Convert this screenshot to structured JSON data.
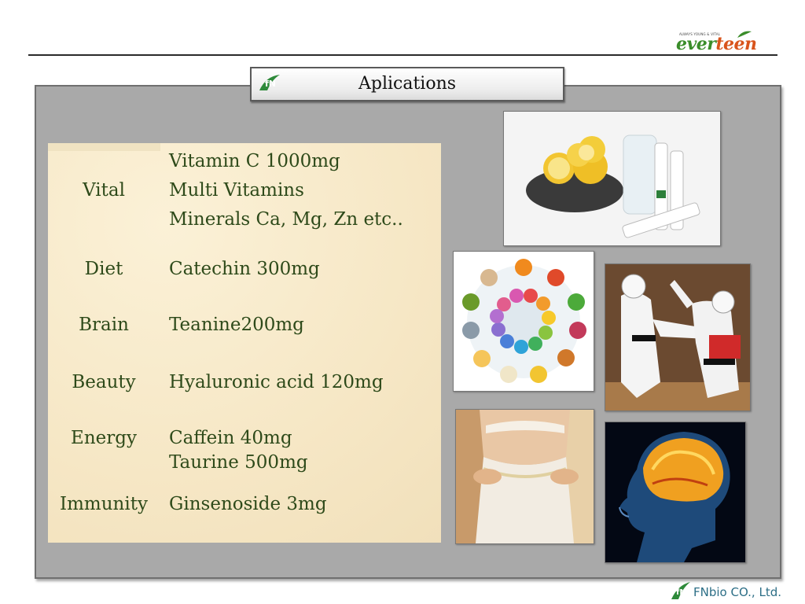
{
  "brand": {
    "tagline": "ALWAYS YOUNG & VITAL",
    "logo_left": "ever",
    "logo_right": "teen"
  },
  "title": "Aplications",
  "rows": [
    {
      "category": "Vital",
      "lines": [
        "Vitamin C 1000mg",
        "Multi Vitamins",
        "Minerals Ca, Mg, Zn etc.."
      ]
    },
    {
      "category": "Diet",
      "lines": [
        "Catechin 300mg"
      ]
    },
    {
      "category": "Brain",
      "lines": [
        "Teanine200mg"
      ]
    },
    {
      "category": "Beauty",
      "lines": [
        "Hyaluronic acid 120mg"
      ]
    },
    {
      "category": "Energy",
      "lines": [
        "Caffein 40mg",
        "Taurine 500mg"
      ]
    },
    {
      "category": "Immunity",
      "lines": [
        "Ginsenoside 3mg"
      ]
    }
  ],
  "footer": {
    "company": "FNbio CO., Ltd."
  },
  "colors": {
    "text_green": "#2e4a1a",
    "panel_gray": "#a9a9a9",
    "logo_green": "#3a8d2a",
    "logo_orange": "#d9541c",
    "footer_blue": "#2c6e86"
  }
}
